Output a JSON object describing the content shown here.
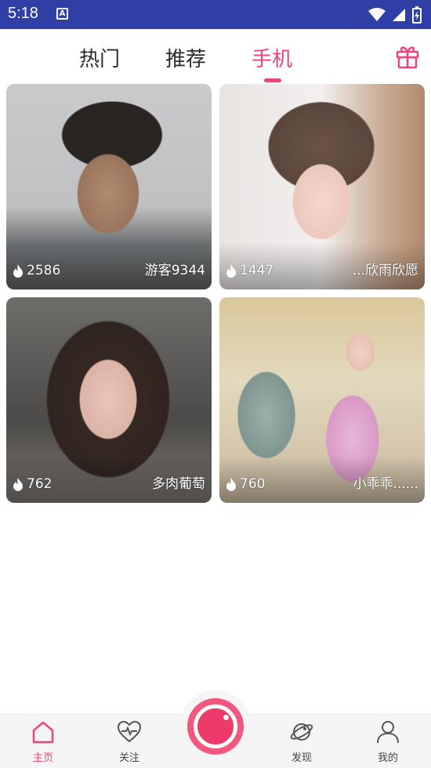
{
  "status_bar": {
    "time": "5:18",
    "notification_letter": "A"
  },
  "tabs": [
    {
      "label": "热门",
      "active": false
    },
    {
      "label": "推荐",
      "active": false
    },
    {
      "label": "手机",
      "active": true
    }
  ],
  "cards": [
    {
      "hot": "2586",
      "name": "游客9344"
    },
    {
      "hot": "1447",
      "name": "...欣雨欣愿"
    },
    {
      "hot": "762",
      "name": "多肉葡萄"
    },
    {
      "hot": "760",
      "name": "小乖乖......"
    }
  ],
  "bottom_nav": [
    {
      "label": "主页",
      "icon": "home-icon",
      "active": true
    },
    {
      "label": "关注",
      "icon": "heart-pulse-icon",
      "active": false
    },
    {
      "label": "发现",
      "icon": "planet-icon",
      "active": false
    },
    {
      "label": "我的",
      "icon": "user-icon",
      "active": false
    }
  ],
  "colors": {
    "accent": "#e8467f",
    "status_bar": "#2f3fa5"
  }
}
